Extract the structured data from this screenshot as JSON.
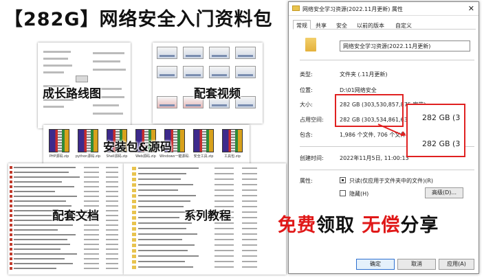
{
  "promo_left": {
    "title": "【282G】网络安全入门资料包",
    "labels": {
      "mindmap": "成长路线图",
      "videos": "配套视频",
      "tools": "安装包&源码",
      "docs": "配套文档",
      "courses": "系列教程"
    },
    "zip_files": [
      "PHP源码.zip",
      "python源码.zip",
      "Shell源码.zip",
      "Web源码.zip",
      "Windows一键源码.zip",
      "安全工具.zip",
      "工具包.zip"
    ]
  },
  "dialog": {
    "title": "网络安全学习资源(2022.11月更新) 属性",
    "close_label": "✕",
    "tabs": [
      "常规",
      "共享",
      "安全",
      "以前的版本",
      "自定义"
    ],
    "folder_name": "网络安全学习资源(2022.11月更新)",
    "props": {
      "type_label": "类型:",
      "type_value": "文件夹 (.11月更新)",
      "location_label": "位置:",
      "location_value": "D:\\01网络安全",
      "size_label": "大小:",
      "size_value": "282 GB (303,530,857,875 字节)",
      "disk_label": "占用空间:",
      "disk_value": "282 GB (303,534,861,632 字节)",
      "contains_label": "包含:",
      "contains_value": "1,986 个文件, 706 个文件夹",
      "created_label": "创建时间:",
      "created_value": "2022年11月5日, 11:00:13",
      "attr_label": "属性:",
      "readonly_label": "只读(仅应用于文件夹中的文件)(R)",
      "hidden_label": "隐藏(H)",
      "advanced_label": "高级(D)..."
    },
    "zoom": [
      "282 GB (3",
      "282 GB (3"
    ],
    "buttons": {
      "ok": "确定",
      "cancel": "取消",
      "apply": "应用(A)"
    }
  },
  "promo_right": {
    "part1": "免费",
    "part2": "领取 ",
    "part3": "无偿",
    "part4": "分享"
  },
  "colors": {
    "accent_red": "#e02020",
    "folder_yellow": "#e8c34e"
  }
}
